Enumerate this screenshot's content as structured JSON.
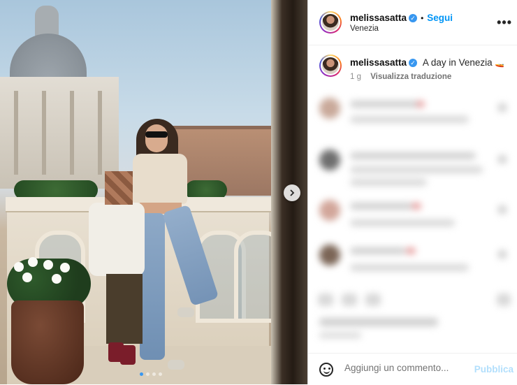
{
  "post": {
    "username": "melissasatta",
    "follow_label": "Segui",
    "location": "Venezia",
    "caption_text": "A day in Venezia",
    "caption_emoji": "🚤",
    "time_ago": "1 g",
    "translate_label": "Visualizza traduzione",
    "more_icon": "more-horizontal-icon",
    "photo_alt": "Photo"
  },
  "carousel": {
    "slide_count": 4,
    "active_slide": 1
  },
  "comment_box": {
    "placeholder": "Aggiungi un commento...",
    "publish_label": "Pubblica"
  },
  "colors": {
    "accent": "#0095f6",
    "verified": "#3897f0"
  }
}
